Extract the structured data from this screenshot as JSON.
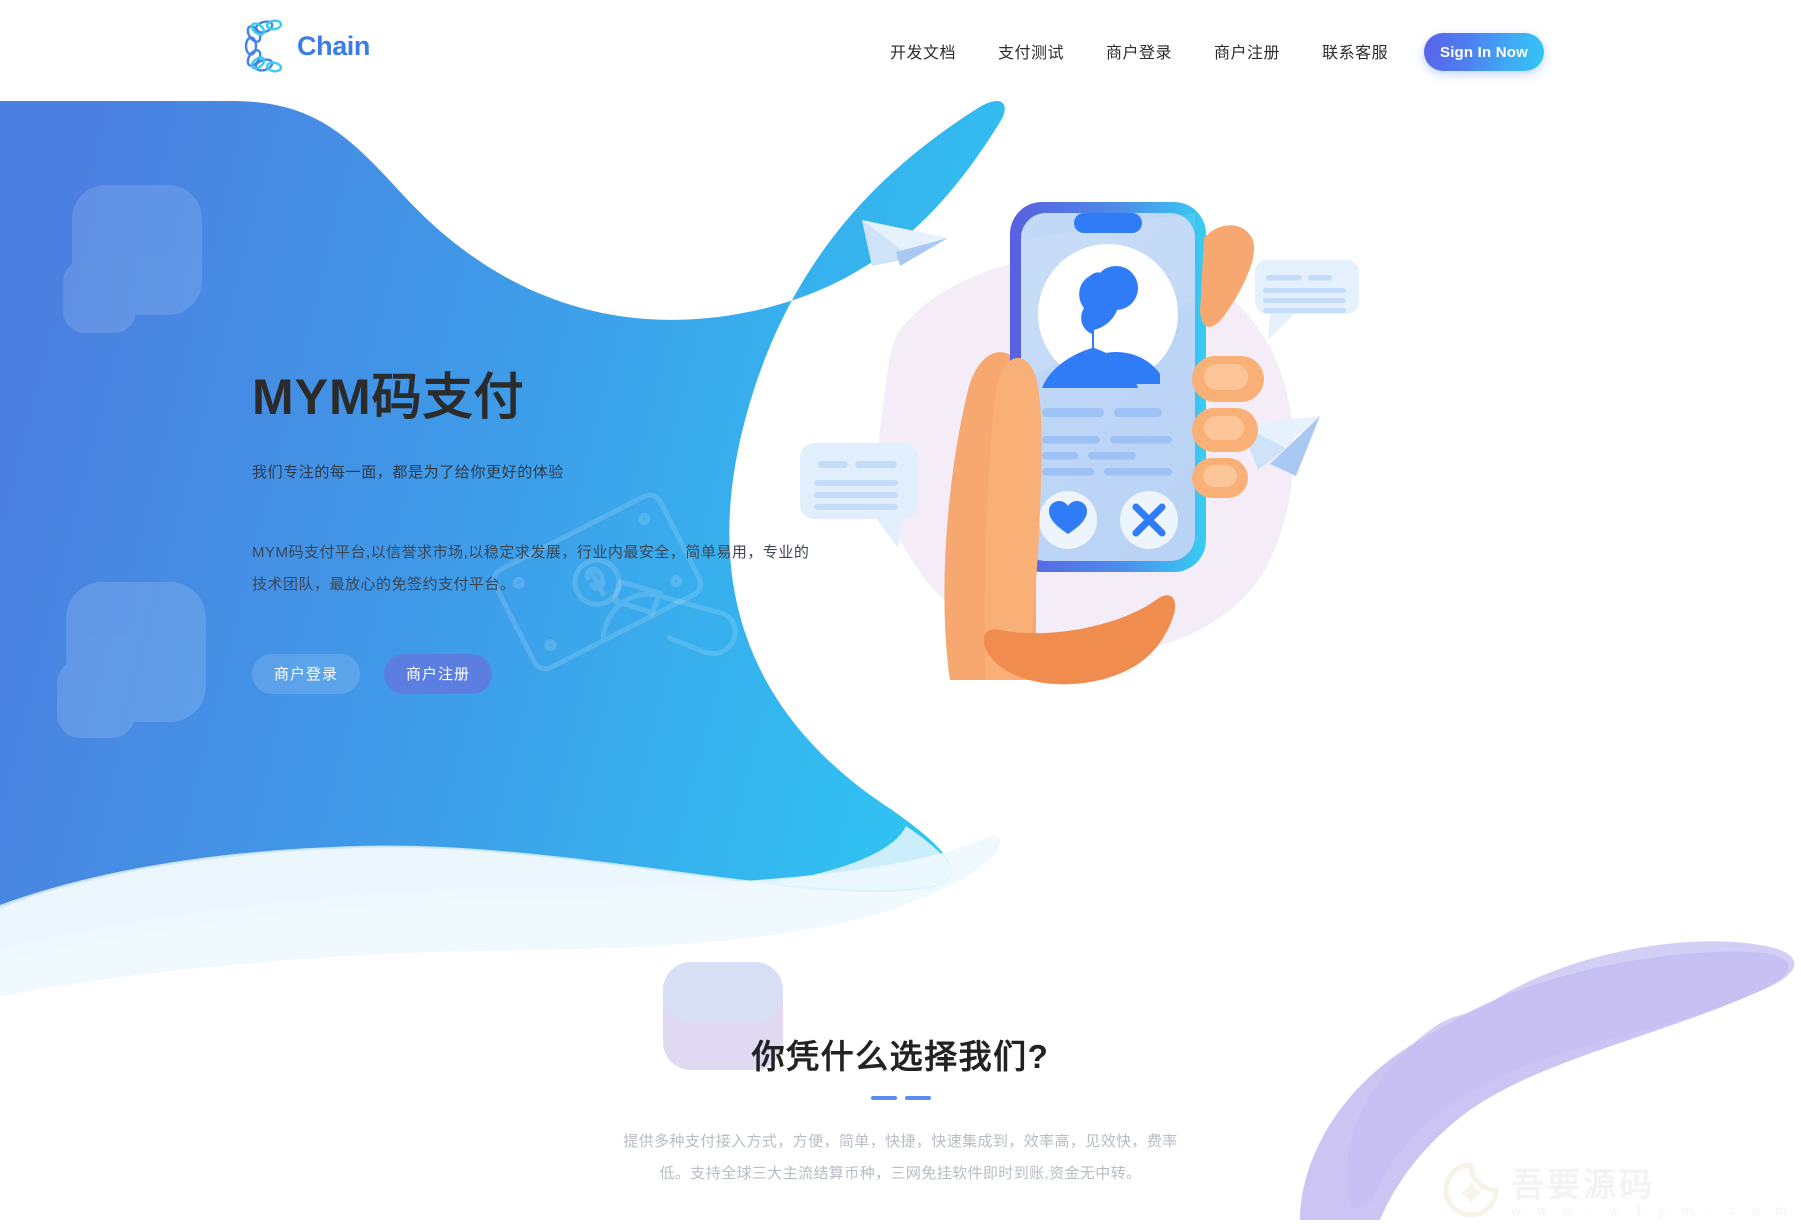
{
  "brand": {
    "name": "Chain",
    "logo_icon": "chain-link-c-icon",
    "color": "#3b7ce8"
  },
  "nav": {
    "items": [
      {
        "label": "开发文档",
        "name": "nav-item-dev-docs"
      },
      {
        "label": "支付测试",
        "name": "nav-item-payment-test"
      },
      {
        "label": "商户登录",
        "name": "nav-item-merchant-login"
      },
      {
        "label": "商户注册",
        "name": "nav-item-merchant-register"
      },
      {
        "label": "联系客服",
        "name": "nav-item-contact-support"
      }
    ],
    "signin_label": "Sign In Now"
  },
  "hero": {
    "title": "MYM码支付",
    "subtitle": "我们专注的每一面，都是为了给你更好的体验",
    "description": "MYM码支付平台,以信誉求市场,以稳定求发展，行业内最安全，简单易用，专业的技术团队，最放心的免签约支付平台。",
    "btn_login": "商户登录",
    "btn_register": "商户注册",
    "illustration": "hand-holding-phone-illustration"
  },
  "features": {
    "title": "你凭什么选择我们?",
    "description": "提供多种支付接入方式，方便，简单，快捷，快速集成到，效率高，见效快，费率低。支持全球三大主流结算币种，三网免挂软件即时到账,资金无中转。"
  },
  "watermark": {
    "text": "吾要源码",
    "url": "w w w . w 1 y m . c o m"
  },
  "colors": {
    "accent": "#3b7ce8",
    "hero_gradient_start": "#4c7fe0",
    "hero_gradient_end": "#2fc0f0",
    "purple_blob": "#c3bdf2",
    "divider": "#5b8def"
  }
}
